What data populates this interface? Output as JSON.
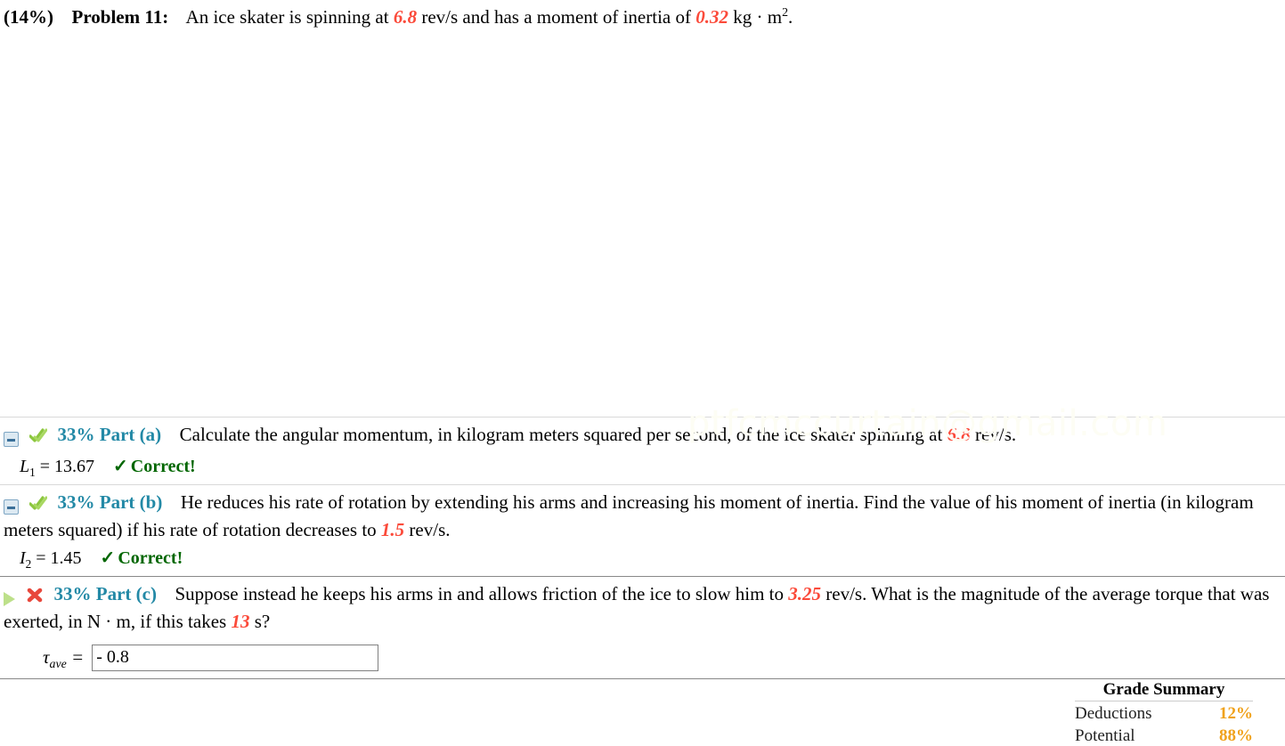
{
  "problem": {
    "percent": "(14%)",
    "label": "Problem 11:",
    "text_1": "An ice skater is spinning at",
    "value_rate": "6.8",
    "text_2": "rev/s and has a moment of inertia of",
    "value_inertia": "0.32",
    "text_3": "kg · m",
    "exponent": "2",
    "text_4": "."
  },
  "watermark": "ptfcmccurtain@gmail.com",
  "parts": [
    {
      "toggle_icon": "collapse-box-icon",
      "status_icon": "green-double-check-icon",
      "title": "33% Part (a)",
      "text_1": "Calculate the angular momentum, in kilogram meters squared per second, of the ice skater spinning at",
      "value": "6.8",
      "text_2": "rev/s.",
      "answer_var": "L",
      "answer_sub": "1",
      "answer_eq": "=",
      "answer_value": "13.67",
      "result_check": "✓",
      "result_text": "Correct!"
    },
    {
      "toggle_icon": "collapse-box-icon",
      "status_icon": "green-double-check-icon",
      "title": "33% Part (b)",
      "text_1": "He reduces his rate of rotation by extending his arms and increasing his moment of inertia. Find the value of his moment of inertia (in kilogram meters squared) if his rate of rotation decreases to",
      "value": "1.5",
      "text_2": "rev/s.",
      "answer_var": "I",
      "answer_sub": "2",
      "answer_eq": "=",
      "answer_value": "1.45",
      "result_check": "✓",
      "result_text": "Correct!"
    },
    {
      "toggle_icon": "expand-triangle-icon",
      "status_icon": "red-x-incorrect-icon",
      "title": "33% Part (c)",
      "text_1": "Suppose instead he keeps his arms in and allows friction of the ice to slow him to",
      "value": "3.25",
      "text_2": "rev/s. What is the magnitude of the average torque that was exerted, in N · m, if this takes",
      "value_2": "13",
      "text_3": "s?",
      "answer_var": "τ",
      "answer_sub": "ave",
      "answer_eq": "=",
      "input_value": "- 0.8",
      "input_placeholder": ""
    }
  ],
  "grade_summary": {
    "title": "Grade Summary",
    "rows": [
      {
        "name": "Deductions",
        "value": "12%"
      },
      {
        "name": "Potential",
        "value": "88%"
      }
    ]
  },
  "colors": {
    "highlight": "#fb4a3a",
    "part_title": "#2389a6",
    "correct": "#006600",
    "grade_value": "#f0a21c"
  }
}
